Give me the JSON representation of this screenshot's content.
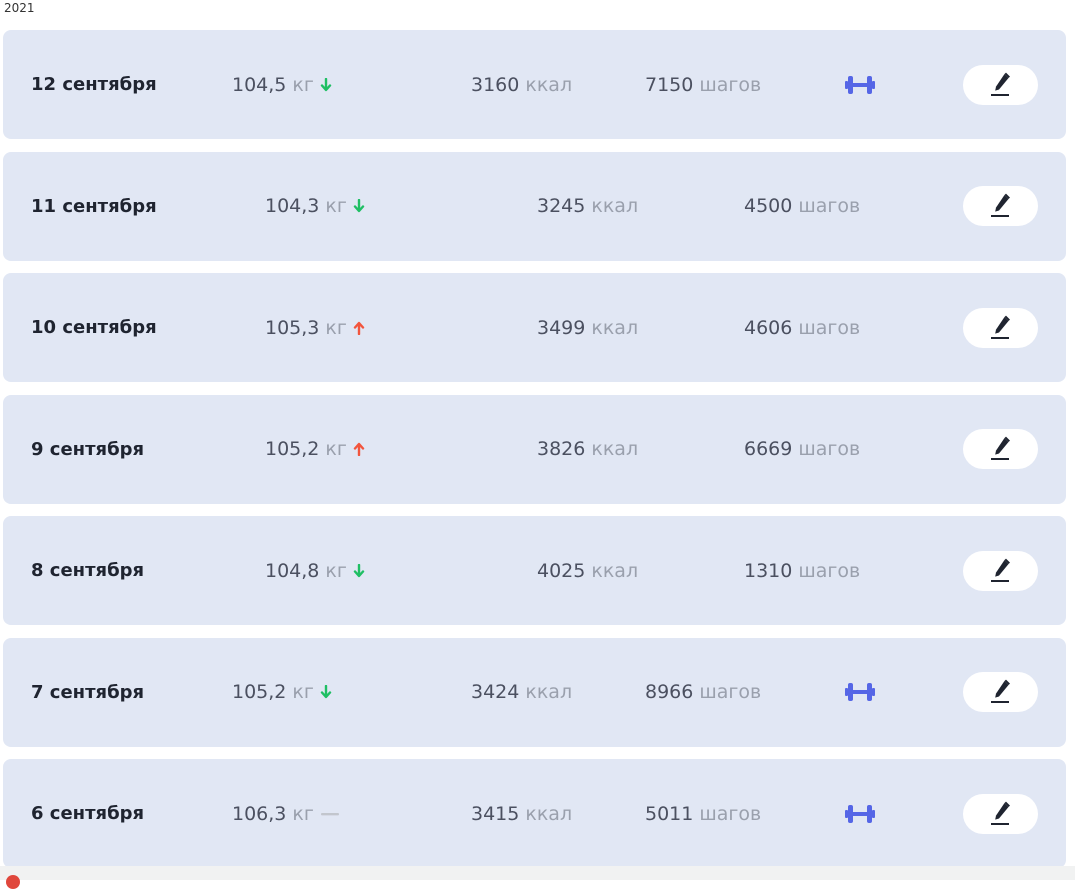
{
  "year": "2021",
  "colors": {
    "row_bg": "#e1e7f4",
    "trend_down": "#1fbf64",
    "trend_up": "#f2553d",
    "trend_flat": "#c2c6cd",
    "gym_icon": "#5566e6"
  },
  "units": {
    "weight": "кг",
    "calories": "ккал",
    "steps": "шагов"
  },
  "entries": [
    {
      "date": "12 сентября",
      "weight": "104,5",
      "trend": "down",
      "calories": "3160",
      "steps": "7150",
      "workout": true,
      "edit_icon": "pencil-icon"
    },
    {
      "date": "11 сентября",
      "weight": "104,3",
      "trend": "down",
      "calories": "3245",
      "steps": "4500",
      "workout": false,
      "edit_icon": "pencil-icon"
    },
    {
      "date": "10 сентября",
      "weight": "105,3",
      "trend": "up",
      "calories": "3499",
      "steps": "4606",
      "workout": false,
      "edit_icon": "pencil-icon"
    },
    {
      "date": "9 сентября",
      "weight": "105,2",
      "trend": "up",
      "calories": "3826",
      "steps": "6669",
      "workout": false,
      "edit_icon": "pencil-icon"
    },
    {
      "date": "8 сентября",
      "weight": "104,8",
      "trend": "down",
      "calories": "4025",
      "steps": "1310",
      "workout": false,
      "edit_icon": "pencil-icon"
    },
    {
      "date": "7 сентября",
      "weight": "105,2",
      "trend": "down",
      "calories": "3424",
      "steps": "8966",
      "workout": true,
      "edit_icon": "pencil-icon"
    },
    {
      "date": "6 сентября",
      "weight": "106,3",
      "trend": "flat",
      "calories": "3415",
      "steps": "5011",
      "workout": true,
      "edit_icon": "pencil-icon"
    }
  ]
}
